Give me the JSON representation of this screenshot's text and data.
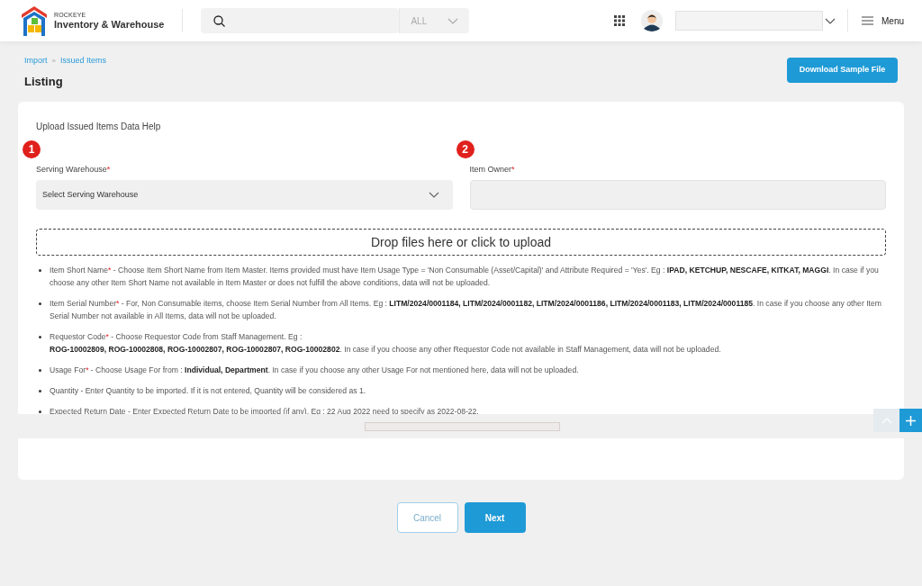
{
  "header": {
    "brand_small": "ROCKEYE",
    "brand": "Inventory & Warehouse",
    "search": {
      "scope": "ALL"
    },
    "menu": "Menu"
  },
  "breadcrumb": [
    "Import",
    "Issued Items"
  ],
  "breadcrumb_separator": "»",
  "page_title": "Listing",
  "download_button": "Download Sample File",
  "help_title": "Upload Issued Items Data Help",
  "fields": [
    {
      "badge": "1",
      "label": "Serving Warehouse",
      "required_mark": "*",
      "kind": "select",
      "value": "Select Serving Warehouse"
    },
    {
      "badge": "2",
      "label": "Item Owner",
      "required_mark": "*",
      "kind": "text"
    }
  ],
  "dropzone": "Drop files here or click to upload",
  "help_items": [
    {
      "label": "Item Short Name",
      "required_mark": "*",
      "text": " - Choose Item Short Name from Item Master. Items provided must have Item Usage Type = 'Non Consumable (Asset/Capital)' and Attribute Required = 'Yes'. Eg : **IPAD, KETCHUP, NESCAFE, KITKAT, MAGGI**. In case if you choose any other Item Short Name not available in Item Master or does not fulfill the above conditions, data will not be uploaded."
    },
    {
      "label": "Item Serial Number",
      "required_mark": "*",
      "text": " - For, Non Consumable items, choose Item Serial Number from All Items. Eg : **LITM/2024/0001184, LITM/2024/0001182, LITM/2024/0001186, LITM/2024/0001183, LITM/2024/0001185**. In case if you choose any other Item Serial Number not available in All Items, data will not be uploaded."
    },
    {
      "label": "Requestor Code",
      "required_mark": "*",
      "text": " - Choose Requestor Code from Staff Management. Eg :",
      "text_2": "**ROG-10002809, ROG-10002808, ROG-10002807, ROG-10002807, ROG-10002802**. In case if you choose any other Requestor Code not available in Staff Management, data will not be uploaded."
    },
    {
      "label": "Usage For",
      "required_mark": "*",
      "text": " - Choose Usage For from : **Individual, Department**. In case if you choose any other Usage For not mentioned here, data will not be uploaded."
    },
    {
      "label": "Quantity",
      "text": " - Enter Quantity to be imported. If it is not entered, Quantity will be considered as 1."
    },
    {
      "label": "Expected Return Date",
      "text": " - Enter Expected Return Date to be imported (if any). Eg : 22 Aug 2022 need to specify as 2022-08-22."
    }
  ],
  "buttons": [
    {
      "label": "Cancel",
      "kind": "secondary"
    },
    {
      "label": "Next",
      "kind": "primary"
    }
  ]
}
